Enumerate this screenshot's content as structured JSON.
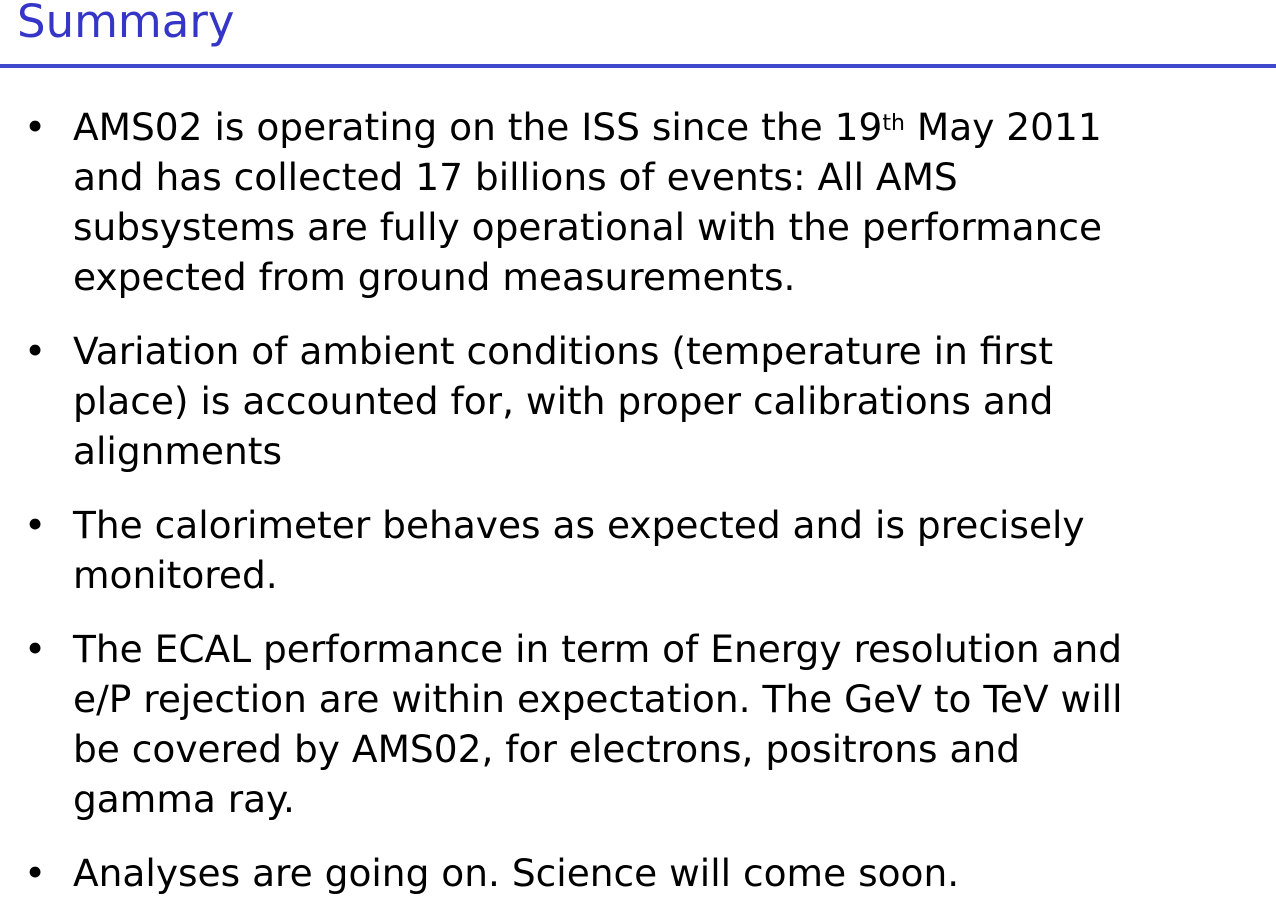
{
  "title": "Summary",
  "colors": {
    "title": "#3535c8",
    "rule": "#3f48cc",
    "text": "#000000"
  },
  "bullet_symbol": "•",
  "bullets": [
    {
      "line1_before": "AMS02 is operating on the ISS since the 19",
      "line1_sup": "th",
      "line1_after": " May 2011",
      "line2": "and has collected 17 billions of events: All AMS",
      "line3": "subsystems are fully operational with the performance",
      "line4": "expected from ground measurements."
    },
    {
      "line1": "Variation of ambient conditions (temperature in first",
      "line2": "place) is accounted for, with proper calibrations and",
      "line3": "alignments"
    },
    {
      "line1": "The calorimeter behaves as expected and is precisely",
      "line2": "monitored."
    },
    {
      "line1": "The ECAL performance in term of Energy resolution and",
      "line2": "e/P rejection are within expectation. The GeV to TeV will",
      "line3": "be covered by AMS02, for electrons, positrons and",
      "line4": "gamma ray."
    },
    {
      "line1": "Analyses are going on.  Science will come soon."
    }
  ]
}
